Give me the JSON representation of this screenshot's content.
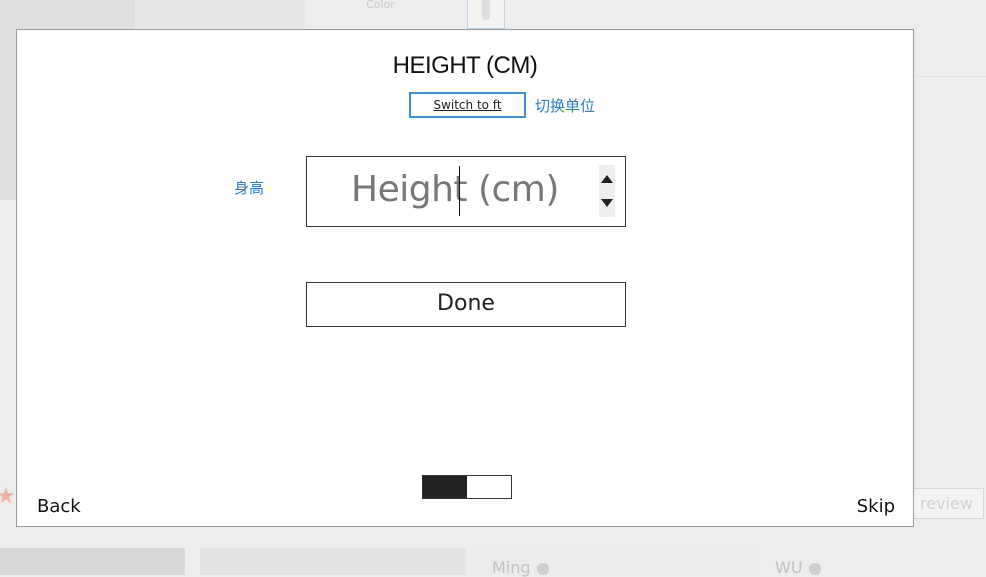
{
  "background": {
    "color_label": "Color",
    "reviewer_names": [
      "Ming",
      "WU"
    ]
  },
  "modal": {
    "title": "HEIGHT (CM)",
    "switch_button_label": "Switch to ft",
    "switch_note": "切换单位",
    "height_label": "身高",
    "height_input": {
      "value": "",
      "placeholder": "Height (cm)"
    },
    "done_label": "Done",
    "progress": {
      "step": 1,
      "total": 2,
      "fraction": 0.5
    },
    "back_label": "Back",
    "skip_label": "Skip"
  },
  "colors": {
    "accent_blue": "#2a7dc9",
    "switch_border": "#3d8fd6",
    "progress_fill": "#232323"
  },
  "icons": {
    "spinner_up": "triangle-up-icon",
    "spinner_down": "triangle-down-icon"
  }
}
